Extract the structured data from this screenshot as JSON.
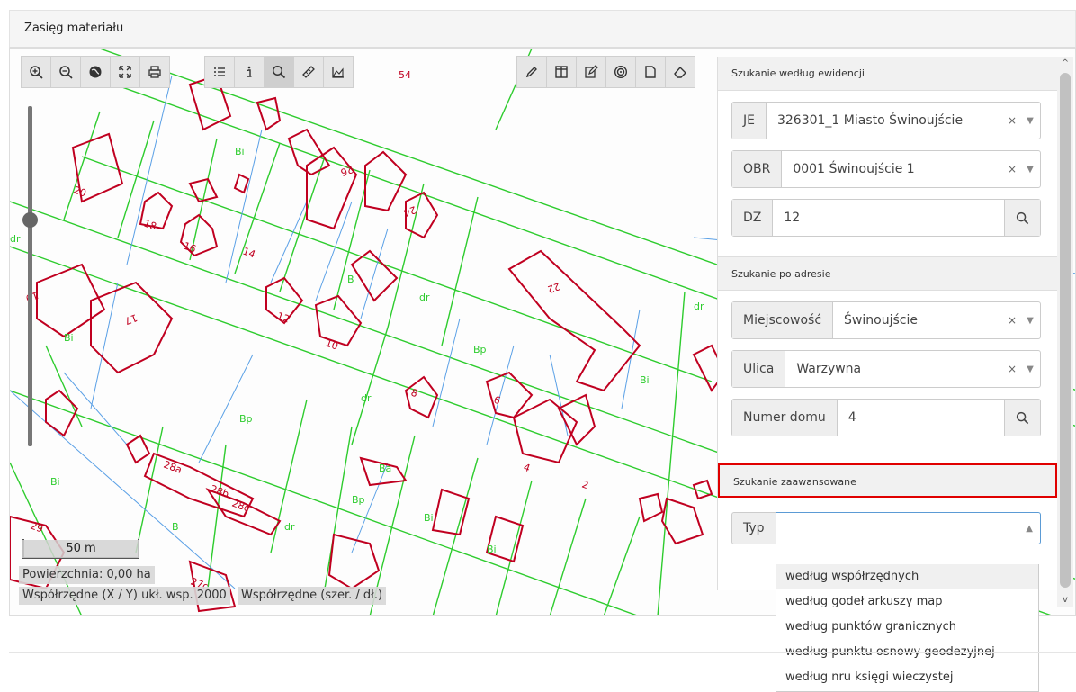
{
  "panel": {
    "title": "Zasięg materiału"
  },
  "toolbar_left": [
    {
      "name": "zoom-in-icon",
      "glyph": "zoomin"
    },
    {
      "name": "zoom-out-icon",
      "glyph": "zoomout"
    },
    {
      "name": "globe-icon",
      "glyph": "globe"
    },
    {
      "name": "fullscreen-icon",
      "glyph": "expand"
    },
    {
      "name": "print-icon",
      "glyph": "print"
    }
  ],
  "toolbar_mid": [
    {
      "name": "layers-list-icon",
      "glyph": "list"
    },
    {
      "name": "info-icon",
      "glyph": "info"
    },
    {
      "name": "search-icon",
      "glyph": "search",
      "active": true
    },
    {
      "name": "measure-ruler-icon",
      "glyph": "ruler"
    },
    {
      "name": "area-chart-icon",
      "glyph": "area"
    }
  ],
  "toolbar_right": [
    {
      "name": "pencil-icon",
      "glyph": "pencil"
    },
    {
      "name": "columns-icon",
      "glyph": "columns"
    },
    {
      "name": "edit-icon",
      "glyph": "edit"
    },
    {
      "name": "target-icon",
      "glyph": "target"
    },
    {
      "name": "file-icon",
      "glyph": "file"
    },
    {
      "name": "eraser-icon",
      "glyph": "eraser"
    }
  ],
  "map": {
    "scale_label": "50 m",
    "area_label": "Powierzchnia: 0,00 ha",
    "coords_2000": "Współrzędne (X / Y) ukł. wsp. 2000",
    "coords_geo": "Współrzędne (szer. / dł.)",
    "labels": [
      {
        "t": "54"
      },
      {
        "t": "20"
      },
      {
        "t": "18"
      },
      {
        "t": "16"
      },
      {
        "t": "14"
      },
      {
        "t": "26"
      },
      {
        "t": "24"
      },
      {
        "t": "22"
      },
      {
        "t": "12"
      },
      {
        "t": "10"
      },
      {
        "t": "8"
      },
      {
        "t": "6"
      },
      {
        "t": "4"
      },
      {
        "t": "2"
      },
      {
        "t": "28a"
      },
      {
        "t": "28b"
      },
      {
        "t": "28c"
      },
      {
        "t": "27c"
      },
      {
        "t": "29"
      },
      {
        "t": "19"
      },
      {
        "t": "17"
      },
      {
        "t": "Bi"
      },
      {
        "t": "dr"
      },
      {
        "t": "Bp"
      },
      {
        "t": "B"
      },
      {
        "t": "Ba"
      }
    ]
  },
  "ewidencja": {
    "header": "Szukanie według ewidencji",
    "je_label": "JE",
    "je_value": "326301_1 Miasto Świnoujście",
    "obr_label": "OBR",
    "obr_value": "0001 Świnoujście 1",
    "dz_label": "DZ",
    "dz_value": "12"
  },
  "adres": {
    "header": "Szukanie po adresie",
    "miejscowosc_label": "Miejscowość",
    "miejscowosc_value": "Świnoujście",
    "ulica_label": "Ulica",
    "ulica_value": "Warzywna",
    "numer_label": "Numer domu",
    "numer_value": "4"
  },
  "zaawansowane": {
    "header": "Szukanie zaawansowane",
    "typ_label": "Typ",
    "typ_value": ""
  },
  "dropdown": {
    "items": [
      "według współrzędnych",
      "według godeł arkuszy map",
      "według punktów granicznych",
      "według punktu osnowy geodezyjnej",
      "według nru księgi wieczystej"
    ]
  },
  "symbols": {
    "clear": "×",
    "arrow_down": "▼",
    "arrow_up": "▲",
    "scroll_up": "^",
    "scroll_down": "v"
  },
  "colors": {
    "parcel": "#2ecc2e",
    "building": "#c00020",
    "boundary": "#5aa0e6",
    "highlight": "#e00000"
  }
}
